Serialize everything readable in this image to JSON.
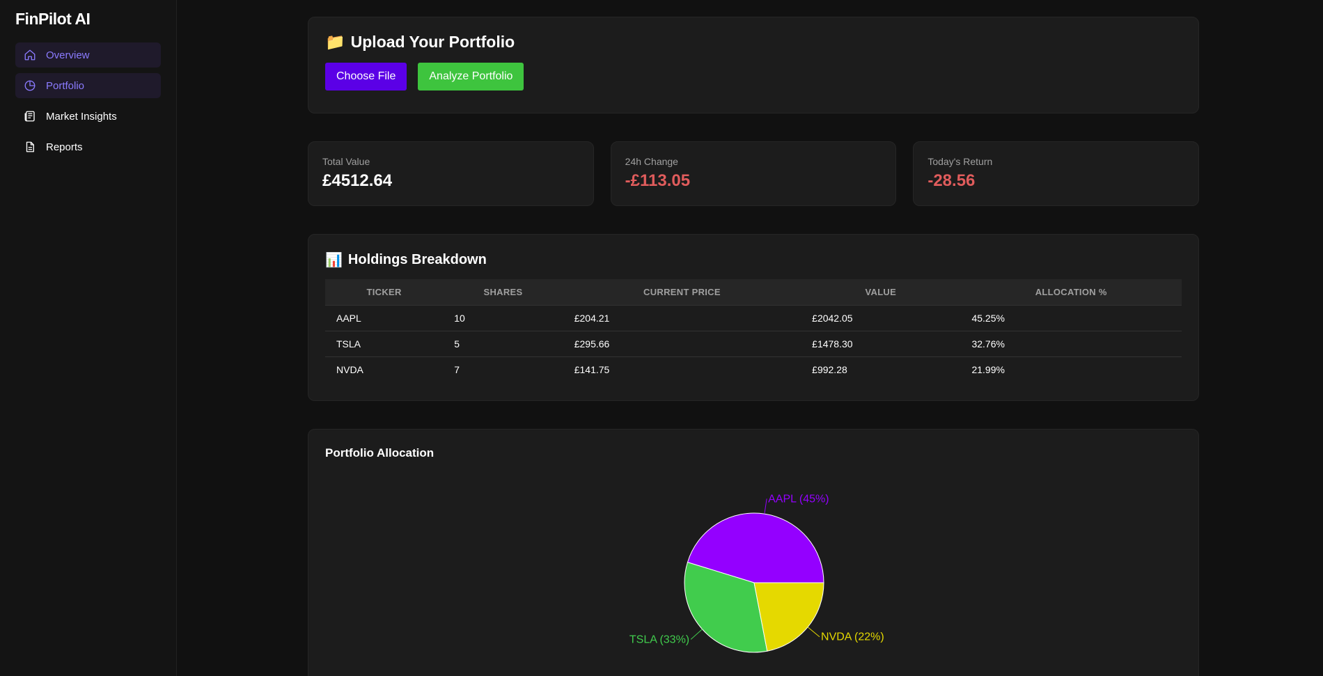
{
  "brand": "FinPilot AI",
  "sidebar": {
    "items": [
      {
        "label": "Overview",
        "icon": "home-icon"
      },
      {
        "label": "Portfolio",
        "icon": "pie-chart-icon"
      },
      {
        "label": "Market Insights",
        "icon": "newspaper-icon"
      },
      {
        "label": "Reports",
        "icon": "document-icon"
      }
    ]
  },
  "upload": {
    "icon": "📁",
    "title": "Upload Your Portfolio",
    "choose_file": "Choose File",
    "analyze": "Analyze Portfolio"
  },
  "stats": [
    {
      "label": "Total Value",
      "value": "£4512.64"
    },
    {
      "label": "24h Change",
      "value": "-£113.05"
    },
    {
      "label": "Today's Return",
      "value": "-28.56"
    }
  ],
  "holdings": {
    "icon": "📊",
    "title": "Holdings Breakdown",
    "headers": [
      "Ticker",
      "Shares",
      "Current Price",
      "Value",
      "Allocation %"
    ],
    "rows": [
      [
        "AAPL",
        "10",
        "£204.21",
        "£2042.05",
        "45.25%"
      ],
      [
        "TSLA",
        "5",
        "£295.66",
        "£1478.30",
        "32.76%"
      ],
      [
        "NVDA",
        "7",
        "£141.75",
        "£992.28",
        "21.99%"
      ]
    ]
  },
  "allocation": {
    "title": "Portfolio Allocation"
  },
  "colors": {
    "accent": "#8b7bff",
    "positive": "#3ec43e",
    "negative": "#e05c5c",
    "primary_button": "#5b00e6"
  },
  "chart_data": {
    "type": "pie",
    "categories": [
      "AAPL",
      "TSLA",
      "NVDA"
    ],
    "values": [
      45.25,
      32.76,
      21.99
    ],
    "labels": [
      "AAPL (45%)",
      "TSLA (33%)",
      "NVDA (22%)"
    ],
    "colors": [
      "#9400ff",
      "#41cc4d",
      "#e5d900"
    ]
  }
}
